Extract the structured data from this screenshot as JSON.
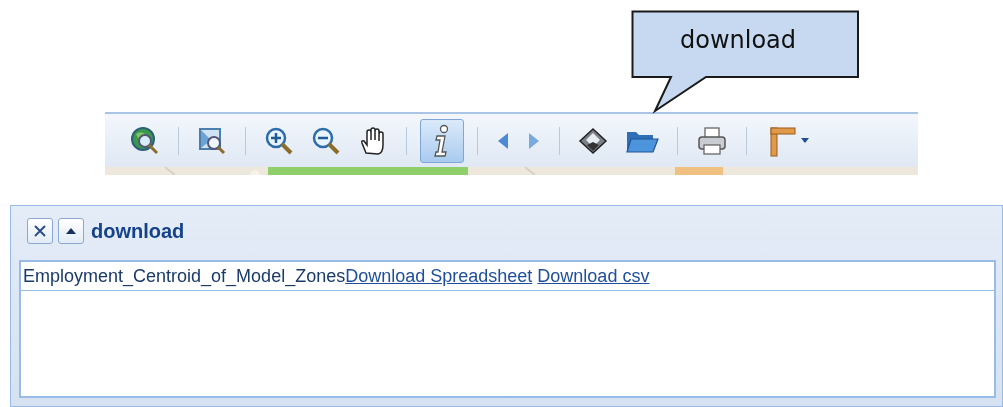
{
  "callout": {
    "text": "download"
  },
  "toolbar": {
    "groups": [
      [
        {
          "kind": "globe",
          "selected": false
        }
      ],
      [
        {
          "kind": "zoom-extent",
          "selected": false
        }
      ],
      [
        {
          "kind": "zoom-in",
          "selected": false
        },
        {
          "kind": "zoom-out",
          "selected": false
        },
        {
          "kind": "pan",
          "selected": false
        }
      ],
      [
        {
          "kind": "info",
          "selected": true
        }
      ],
      [
        {
          "kind": "back",
          "selected": false
        },
        {
          "kind": "forward",
          "selected": false
        }
      ],
      [
        {
          "kind": "download",
          "selected": false
        },
        {
          "kind": "open",
          "selected": false
        }
      ],
      [
        {
          "kind": "print",
          "selected": false
        }
      ],
      [
        {
          "kind": "measure",
          "selected": false
        }
      ]
    ]
  },
  "panel": {
    "title": "download",
    "rows": [
      {
        "layer": "Employment_Centroid_of_Model_Zones",
        "links": [
          "Download Spreadsheet",
          "Download csv"
        ]
      }
    ]
  }
}
